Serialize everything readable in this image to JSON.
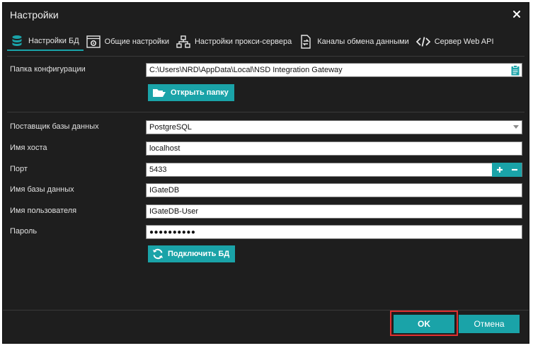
{
  "window": {
    "title": "Настройки"
  },
  "tabs": [
    {
      "label": "Настройки БД",
      "icon": "database-icon"
    },
    {
      "label": "Общие настройки",
      "icon": "settings-window-icon"
    },
    {
      "label": "Настройки прокси-сервера",
      "icon": "network-icon"
    },
    {
      "label": "Каналы обмена данными",
      "icon": "file-exchange-icon"
    },
    {
      "label": "Сервер Web API",
      "icon": "code-icon"
    }
  ],
  "config": {
    "folder_label": "Папка конфигурации",
    "folder_value": "C:\\Users\\NRD\\AppData\\Local\\NSD Integration Gateway",
    "open_folder_label": "Открыть папку"
  },
  "db": {
    "provider_label": "Поставщик базы данных",
    "provider_value": "PostgreSQL",
    "host_label": "Имя хоста",
    "host_value": "localhost",
    "port_label": "Порт",
    "port_value": "5433",
    "dbname_label": "Имя базы данных",
    "dbname_value": "IGateDB",
    "user_label": "Имя пользователя",
    "user_value": "IGateDB-User",
    "password_label": "Пароль",
    "password_value": "●●●●●●●●●●",
    "connect_label": "Подключить БД"
  },
  "footer": {
    "ok_label": "OK",
    "cancel_label": "Отмена"
  },
  "colors": {
    "accent": "#1aa3a8",
    "background": "#1e1e1e",
    "highlight": "#e03030"
  }
}
